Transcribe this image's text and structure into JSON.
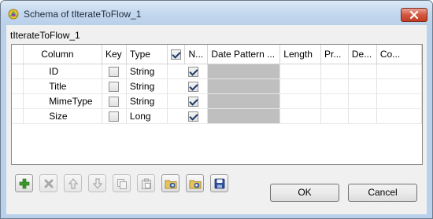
{
  "window": {
    "title": "Schema of tIterateToFlow_1",
    "component_label": "tIterateToFlow_1"
  },
  "table": {
    "headers": {
      "column": "Column",
      "key": "Key",
      "type": "Type",
      "nullable": "N...",
      "date_pattern": "Date Pattern ...",
      "length": "Length",
      "precision": "Pr...",
      "default": "De...",
      "comment": "Co..."
    },
    "header_nullable_checked": true,
    "rows": [
      {
        "name": "ID",
        "key": false,
        "type": "String",
        "nullable": true
      },
      {
        "name": "Title",
        "key": false,
        "type": "String",
        "nullable": true
      },
      {
        "name": "MimeType",
        "key": false,
        "type": "String",
        "nullable": true
      },
      {
        "name": "Size",
        "key": false,
        "type": "Long",
        "nullable": true
      }
    ]
  },
  "toolbar": {
    "buttons": [
      {
        "name": "add-row-button",
        "icon": "plus-icon",
        "enabled": true
      },
      {
        "name": "remove-row-button",
        "icon": "x-icon",
        "enabled": false
      },
      {
        "name": "move-up-button",
        "icon": "arrow-up-icon",
        "enabled": false
      },
      {
        "name": "move-down-button",
        "icon": "arrow-down-icon",
        "enabled": false
      },
      {
        "name": "copy-button",
        "icon": "copy-icon",
        "enabled": false
      },
      {
        "name": "paste-button",
        "icon": "paste-icon",
        "enabled": false
      },
      {
        "name": "import-schema-button",
        "icon": "import-folder-icon",
        "enabled": true
      },
      {
        "name": "export-schema-button",
        "icon": "export-folder-icon",
        "enabled": true
      },
      {
        "name": "save-schema-button",
        "icon": "save-disk-icon",
        "enabled": true
      }
    ]
  },
  "buttons": {
    "ok": "OK",
    "cancel": "Cancel"
  }
}
